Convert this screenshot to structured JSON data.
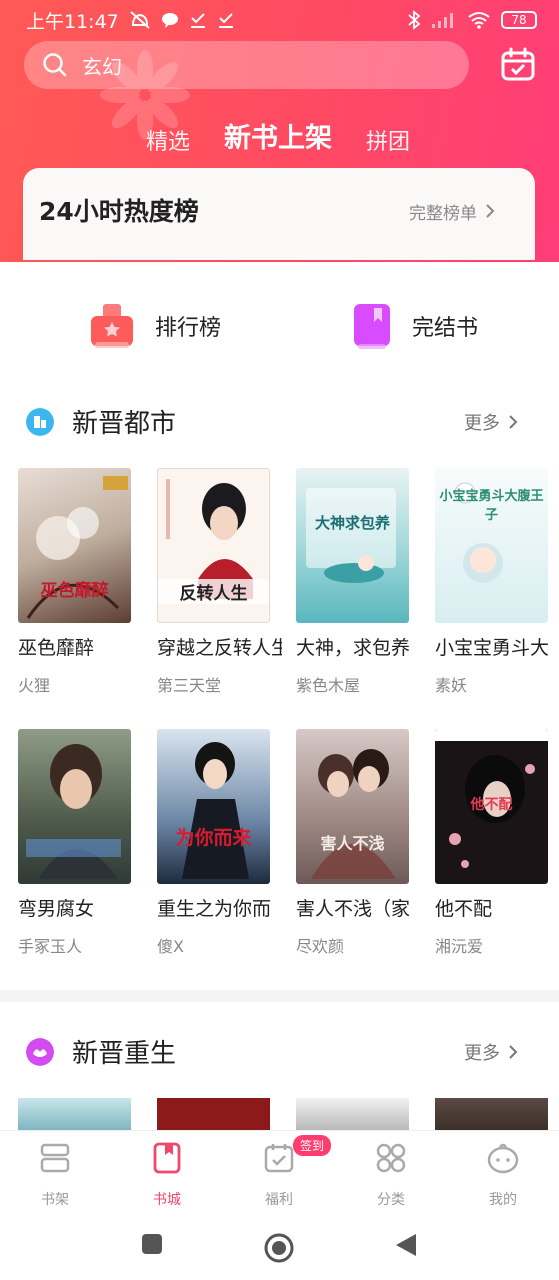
{
  "status_bar": {
    "time": "上午11:47",
    "battery": "78"
  },
  "search": {
    "placeholder": "玄幻"
  },
  "top_tabs": [
    {
      "label": "精选"
    },
    {
      "label": "新书上架"
    },
    {
      "label": "拼团"
    }
  ],
  "hot_list": {
    "title": "24小时热度榜",
    "more": "完整榜单"
  },
  "shortcuts": [
    {
      "label": "排行榜"
    },
    {
      "label": "完结书"
    }
  ],
  "sections": [
    {
      "title": "新晋都市",
      "more": "更多",
      "books": [
        {
          "name": "巫色靡醉",
          "author": "火狸",
          "cover_text": "巫色靡醉"
        },
        {
          "name": "穿越之反转人生",
          "author": "第三天堂",
          "cover_text": "反转人生"
        },
        {
          "name": "大神，求包养",
          "author": "紫色木屋",
          "cover_text": "大神求包养"
        },
        {
          "name": "小宝宝勇斗大",
          "author": "素妖",
          "cover_text": "小宝宝勇斗大腹王子"
        },
        {
          "name": "弯男腐女",
          "author": "手冢玉人",
          "cover_text": ""
        },
        {
          "name": "重生之为你而",
          "author": "傻X",
          "cover_text": "为你而来"
        },
        {
          "name": "害人不浅（家",
          "author": "尽欢颜",
          "cover_text": "害人不浅"
        },
        {
          "name": "他不配",
          "author": "湘沅爱",
          "cover_text": "他不配"
        }
      ]
    },
    {
      "title": "新晋重生",
      "more": "更多"
    }
  ],
  "bottom_nav": [
    {
      "label": "书架",
      "icon": "bookshelf-icon"
    },
    {
      "label": "书城",
      "icon": "book-icon"
    },
    {
      "label": "福利",
      "icon": "calendar-icon"
    },
    {
      "label": "分类",
      "icon": "grid-icon"
    },
    {
      "label": "我的",
      "icon": "face-icon"
    }
  ],
  "sign_badge": "签到",
  "colors": {
    "header_start": "#ff5a55",
    "header_end": "#ff3d78",
    "active_nav": "#ef4868"
  }
}
